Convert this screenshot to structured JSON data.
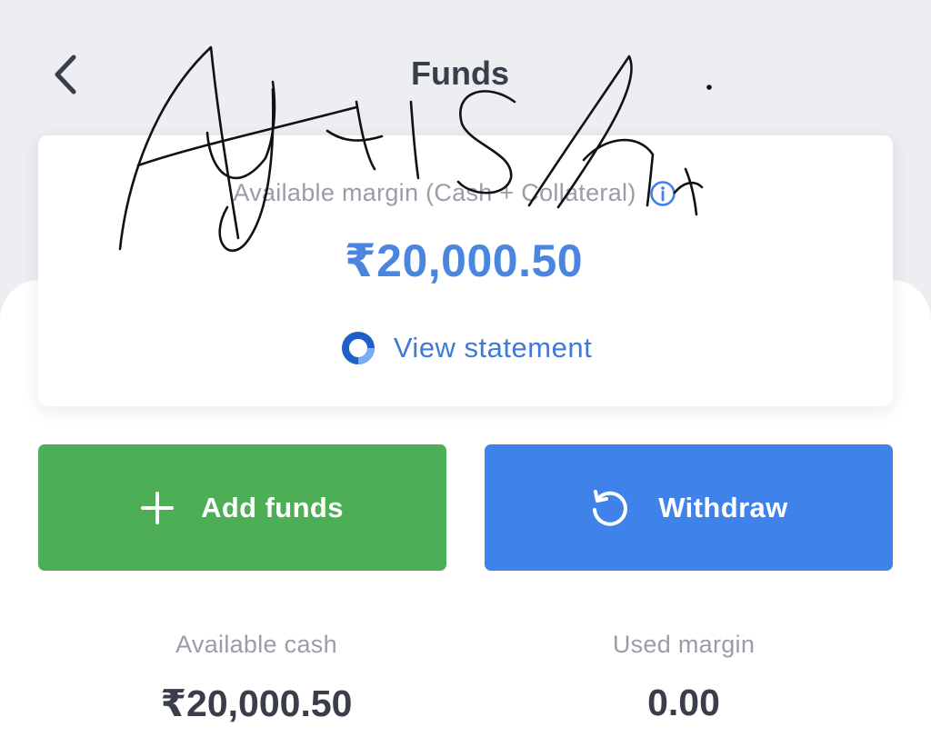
{
  "header": {
    "title": "Funds"
  },
  "margin_card": {
    "label": "Available margin (Cash + Collateral)",
    "amount": "₹20,000.50",
    "statement_link": "View statement"
  },
  "actions": {
    "add_funds_label": "Add funds",
    "withdraw_label": "Withdraw"
  },
  "stats": {
    "available_cash_label": "Available cash",
    "available_cash_value": "₹20,000.50",
    "used_margin_label": "Used margin",
    "used_margin_value": "0.00"
  },
  "overlay": {
    "handwriting": "Ayushi"
  },
  "colors": {
    "accent_blue": "#3f82ea",
    "amount_blue": "#4a86e0",
    "add_green": "#4caf55",
    "muted_text": "#9a9da7",
    "dark_text": "#3a3d4a",
    "top_background": "#eceef2"
  },
  "icons": {
    "back": "chevron-left-icon",
    "info": "info-icon",
    "statement": "ring-icon",
    "add": "plus-icon",
    "withdraw": "undo-arrow-icon"
  }
}
